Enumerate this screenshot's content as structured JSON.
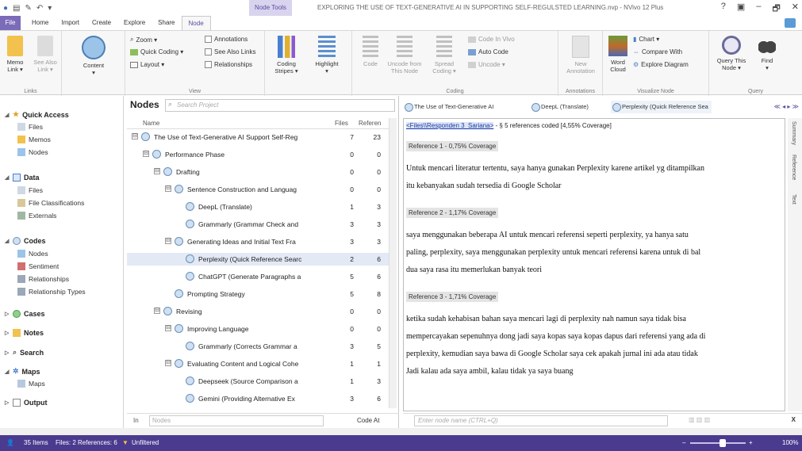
{
  "window": {
    "title": "EXPLORING THE USE OF TEXT-GENERATIVE AI IN SUPPORTING SELF-REGULSTED LEARNING.nvp - NVivo 12 Plus",
    "context_tab": "Node Tools",
    "help": "?",
    "ribbon_display": "▣",
    "minimize": "–",
    "restore": "🗗",
    "close": "✕"
  },
  "tabs": [
    "File",
    "Home",
    "Import",
    "Create",
    "Explore",
    "Share",
    "Node"
  ],
  "ribbon": {
    "links": {
      "memo_link": "Memo\nLink ▾",
      "see_also_link": "See Also\nLink ▾",
      "label": "Links"
    },
    "content": {
      "label_btn": "Content\n▾"
    },
    "view": {
      "zoom": "Zoom ▾",
      "quick_coding": "Quick Coding ▾",
      "layout": "Layout ▾",
      "annotations": "Annotations",
      "see_also_links": "See Also Links",
      "relationships": "Relationships",
      "label": "View"
    },
    "coding_stripes": "Coding\nStripes ▾",
    "highlight": "Highlight\n▾",
    "coding": {
      "code": "Code",
      "uncode_from": "Uncode from\nThis Node",
      "spread_coding": "Spread\nCoding ▾",
      "code_in_vivo": "Code In Vivo",
      "auto_code": "Auto Code",
      "uncode": "Uncode ▾",
      "label": "Coding"
    },
    "annotations": {
      "new_annotation": "New\nAnnotation",
      "label": "Annotations"
    },
    "visualize": {
      "word_cloud": "Word\nCloud",
      "chart": "Chart ▾",
      "compare_with": "Compare With",
      "explore_diagram": "Explore Diagram",
      "label": "Visualize Node"
    },
    "query": {
      "query_this_node": "Query This\nNode ▾",
      "find": "Find\n▾",
      "label": "Query"
    }
  },
  "nav": {
    "quick_access": "Quick Access",
    "qa_items": [
      "Files",
      "Memos",
      "Nodes"
    ],
    "data": "Data",
    "data_items": [
      "Files",
      "File Classifications",
      "Externals"
    ],
    "codes": "Codes",
    "codes_items": [
      "Nodes",
      "Sentiment",
      "Relationships",
      "Relationship Types"
    ],
    "cases": "Cases",
    "notes": "Notes",
    "search": "Search",
    "maps": "Maps",
    "maps_items": [
      "Maps"
    ],
    "output": "Output"
  },
  "nodes_panel": {
    "title": "Nodes",
    "search_placeholder": "Search Project",
    "col_name": "Name",
    "col_files": "Files",
    "col_refs": "Referen",
    "footer_in": "In",
    "footer_scope": "Nodes",
    "footer_code_at": "Code At",
    "rows": [
      {
        "name": "The Use of Text-Generative AI Support Self-Reg",
        "files": "7",
        "refs": "23",
        "level": 0,
        "exp": "⊟"
      },
      {
        "name": "Performance Phase",
        "files": "0",
        "refs": "0",
        "level": 1,
        "exp": "⊟"
      },
      {
        "name": "Drafting",
        "files": "0",
        "refs": "0",
        "level": 2,
        "exp": "⊟"
      },
      {
        "name": "Sentence Construction and Languag",
        "files": "0",
        "refs": "0",
        "level": 3,
        "exp": "⊟"
      },
      {
        "name": "DeepL (Translate)",
        "files": "1",
        "refs": "3",
        "level": 4,
        "exp": ""
      },
      {
        "name": "Grammarly (Grammar Check and",
        "files": "3",
        "refs": "3",
        "level": 4,
        "exp": ""
      },
      {
        "name": "Generating Ideas and Initial Text Fra",
        "files": "3",
        "refs": "3",
        "level": 3,
        "exp": "⊟"
      },
      {
        "name": "Perplexity (Quick Reference Searc",
        "files": "2",
        "refs": "6",
        "level": 4,
        "exp": ""
      },
      {
        "name": "ChatGPT (Generate Paragraphs a",
        "files": "5",
        "refs": "6",
        "level": 4,
        "exp": ""
      },
      {
        "name": "Prompting Strategy",
        "files": "5",
        "refs": "8",
        "level": 3,
        "exp": ""
      },
      {
        "name": "Revising",
        "files": "0",
        "refs": "0",
        "level": 2,
        "exp": "⊟"
      },
      {
        "name": "Improving Language",
        "files": "0",
        "refs": "0",
        "level": 3,
        "exp": "⊟"
      },
      {
        "name": "Grammarly (Corrects Grammar a",
        "files": "3",
        "refs": "5",
        "level": 4,
        "exp": ""
      },
      {
        "name": "Evaluating Content and Logical Cohe",
        "files": "1",
        "refs": "1",
        "level": 3,
        "exp": "⊟"
      },
      {
        "name": "Deepseek (Source Comparison a",
        "files": "1",
        "refs": "3",
        "level": 4,
        "exp": ""
      },
      {
        "name": "Gemini (Providing Alternative Ex",
        "files": "3",
        "refs": "6",
        "level": 4,
        "exp": ""
      }
    ]
  },
  "detail": {
    "tabs": [
      "The Use of Text-Generative AI",
      "DeepL (Translate)",
      "Perplexity (Quick Reference Sea"
    ],
    "tab_nav": "≪ ◂ ▸ ≫",
    "source_link": "<Files\\\\Responden 3_Sariana>",
    "source_summary": "- § 5 references coded  [4,55% Coverage]",
    "refs": [
      {
        "header": "Reference 1 - 0,75% Coverage",
        "lines": [
          "Untuk mencari literatur tertentu, saya hanya gunakan Perplexity karene artikel yg ditampilkan",
          "itu kebanyakan sudah tersedia di Google Scholar"
        ]
      },
      {
        "header": "Reference 2 - 1,17% Coverage",
        "lines": [
          "saya menggunakan beberapa AI untuk mencari referensi seperti perplexity, ya hanya satu",
          "paling, perplexity, saya menggunakan perplexity untuk mencari referensi karena untuk di bal",
          "dua saya rasa itu memerlukan banyak teori"
        ]
      },
      {
        "header": "Reference 3 - 1,71% Coverage",
        "lines": [
          "ketika sudah kehabisan bahan saya mencari lagi di perplexity nah namun saya tidak bisa",
          "mempercayakan sepenuhnya dong jadi saya kopas saya kopas dapus dari referensi yang ada di",
          "perplexity, kemudian saya bawa di Google Scholar saya cek apakah jurnal ini ada atau tidak",
          "Jadi kalau ada saya ambil, kalau tidak ya saya buang"
        ]
      }
    ],
    "side_tabs": [
      "Summary",
      "Reference",
      "Text"
    ],
    "footer_placeholder": "Enter node name (CTRL+Q)",
    "close": "X"
  },
  "status": {
    "items": "35 Items",
    "files_refs": "Files: 2  References: 6",
    "filter": "Unfiltered",
    "zoom": "100%",
    "zoom_level": 0.6
  },
  "colors": {
    "accent": "#4a3b8f",
    "file_tab": "#7b6bb8",
    "node_circle": "#cfe0f2"
  }
}
